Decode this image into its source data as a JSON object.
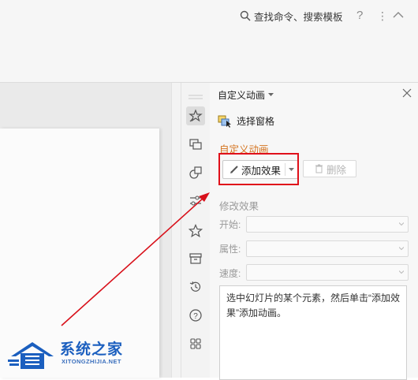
{
  "toolbar": {
    "search_label": "查找命令、搜索模板",
    "help_glyph": "?",
    "more_glyph": "⋮"
  },
  "rail": {
    "icons": [
      "animation-icon",
      "slide-transition-icon",
      "shapes-icon",
      "properties-icon",
      "star-icon",
      "archive-icon",
      "history-icon",
      "help-icon",
      "apps-icon"
    ]
  },
  "pane": {
    "title": "自定义动画",
    "select_pane_label": "选择窗格",
    "section_title": "自定义动画",
    "add_effect_label": "添加效果",
    "delete_label": "删除",
    "modify_title": "修改效果",
    "fields": [
      {
        "label": "开始:",
        "value": ""
      },
      {
        "label": "属性:",
        "value": ""
      },
      {
        "label": "速度:",
        "value": ""
      }
    ],
    "description": "选中幻灯片的某个元素，然后单击“添加效果”添加动画。"
  },
  "watermark": {
    "name": "系统之家",
    "url": "XITONGZHIJIA.NET"
  },
  "colors": {
    "accent_orange": "#d4731e",
    "highlight_red": "#e0101a",
    "annotation_arrow": "#d8101a",
    "watermark_blue": "#1b5fbf"
  }
}
